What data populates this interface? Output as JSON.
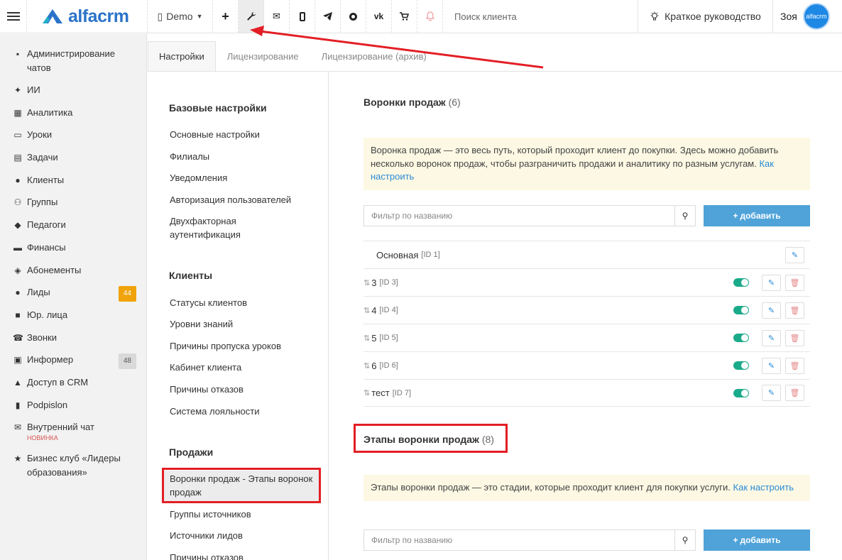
{
  "topbar": {
    "brand": "alfacrm",
    "branch": "Demo",
    "search_placeholder": "Поиск клиента",
    "guide": "Краткое руководство",
    "user_name": "Зоя",
    "avatar_text": "alfacrm",
    "icons": [
      "plus-icon",
      "wrench-icon",
      "mail-icon",
      "phone-icon",
      "telegram-icon",
      "whatsapp-icon",
      "vk-icon",
      "cart-icon",
      "bell-icon"
    ]
  },
  "sidebar": {
    "items": [
      {
        "label": "Администрирование чатов",
        "icon": "chat-admin-icon"
      },
      {
        "label": "ИИ",
        "icon": "sparkle-icon"
      },
      {
        "label": "Аналитика",
        "icon": "map-icon"
      },
      {
        "label": "Уроки",
        "icon": "calendar-icon"
      },
      {
        "label": "Задачи",
        "icon": "clipboard-icon"
      },
      {
        "label": "Клиенты",
        "icon": "user-icon"
      },
      {
        "label": "Группы",
        "icon": "users-icon"
      },
      {
        "label": "Педагоги",
        "icon": "graduation-cap-icon"
      },
      {
        "label": "Финансы",
        "icon": "money-icon"
      },
      {
        "label": "Абонементы",
        "icon": "tag-icon"
      },
      {
        "label": "Лиды",
        "icon": "user-plus-icon",
        "badge": "44"
      },
      {
        "label": "Юр. лица",
        "icon": "briefcase-icon"
      },
      {
        "label": "Звонки",
        "icon": "phone-icon"
      },
      {
        "label": "Информер",
        "icon": "informer-icon",
        "badge": "48"
      },
      {
        "label": "Доступ в CRM",
        "icon": "lock-icon"
      },
      {
        "label": "Podpislon",
        "icon": "document-icon"
      },
      {
        "label": "Внутренний чат",
        "icon": "mail-icon",
        "tag": "НОВИНКА"
      },
      {
        "label": "Бизнес клуб «Лидеры образования»",
        "icon": "star-icon"
      }
    ]
  },
  "tabs": [
    "Настройки",
    "Лицензирование",
    "Лицензирование (архив)"
  ],
  "settings_nav": {
    "groups": [
      {
        "title": "Базовые настройки",
        "items": [
          "Основные настройки",
          "Филиалы",
          "Уведомления",
          "Авторизация пользователей",
          "Двухфакторная аутентификация"
        ]
      },
      {
        "title": "Клиенты",
        "items": [
          "Статусы клиентов",
          "Уровни знаний",
          "Причины пропуска уроков",
          "Кабинет клиента",
          "Причины отказов",
          "Система лояльности"
        ]
      },
      {
        "title": "Продажи",
        "items": [
          "Воронки продаж - Этапы воронок продаж",
          "Группы источников",
          "Источники лидов",
          "Причины отказов"
        ]
      }
    ]
  },
  "funnels": {
    "title": "Воронки продаж",
    "count": "(6)",
    "note": "Воронка продаж — это весь путь, который проходит клиент до покупки. Здесь можно добавить несколько воронок продаж, чтобы разграничить продажи и аналитику по разным услугам.",
    "note_link": "Как настроить",
    "filter_placeholder": "Фильтр по названию",
    "add_label": "добавить",
    "rows": [
      {
        "name": "Основная",
        "id": "[ID 1]"
      },
      {
        "name": "3",
        "id": "[ID 3]"
      },
      {
        "name": "4",
        "id": "[ID 4]"
      },
      {
        "name": "5",
        "id": "[ID 5]"
      },
      {
        "name": "6",
        "id": "[ID 6]"
      },
      {
        "name": "тест",
        "id": "[ID 7]"
      }
    ]
  },
  "stages": {
    "title": "Этапы воронки продаж",
    "count": "(8)",
    "note": "Этапы воронки продаж — это стадии, которые проходит клиент для покупки услуги.",
    "note_link": "Как настроить",
    "filter_placeholder": "Фильтр по названию",
    "add_label": "добавить"
  },
  "colors": {
    "brand": "#2b73c9",
    "accent": "#4fa3d9",
    "toggle": "#1aaa8a",
    "highlight": "#e31e24",
    "note_bg": "#fcf8e3"
  }
}
